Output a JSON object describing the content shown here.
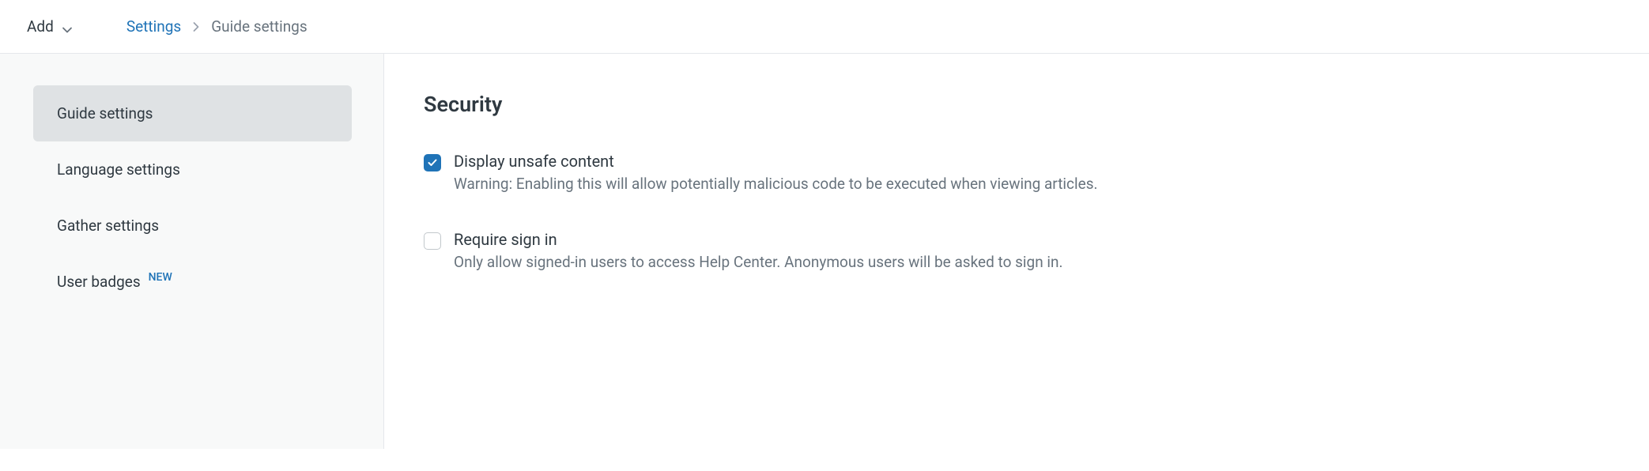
{
  "topbar": {
    "add_label": "Add"
  },
  "breadcrumb": {
    "link": "Settings",
    "current": "Guide settings"
  },
  "sidebar": {
    "items": [
      {
        "label": "Guide settings",
        "active": true
      },
      {
        "label": "Language settings",
        "active": false
      },
      {
        "label": "Gather settings",
        "active": false
      },
      {
        "label": "User badges",
        "active": false,
        "badge": "NEW"
      }
    ]
  },
  "main": {
    "section_title": "Security",
    "options": [
      {
        "label": "Display unsafe content",
        "description": "Warning: Enabling this will allow potentially malicious code to be executed when viewing articles.",
        "checked": true
      },
      {
        "label": "Require sign in",
        "description": "Only allow signed-in users to access Help Center. Anonymous users will be asked to sign in.",
        "checked": false
      }
    ]
  }
}
